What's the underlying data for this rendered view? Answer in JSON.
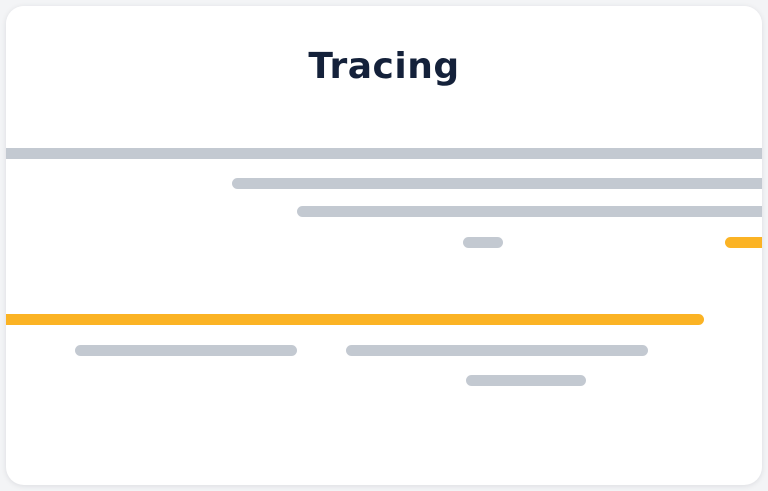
{
  "header": {
    "title": "Tracing"
  },
  "colors": {
    "title": "#14213a",
    "neutral_span": "#c3c9d1",
    "highlight_span": "#fbb324",
    "card_background": "#ffffff"
  },
  "trace": {
    "spans": [
      {
        "id": "span-1",
        "color": "neutral"
      },
      {
        "id": "span-2",
        "color": "neutral"
      },
      {
        "id": "span-3",
        "color": "neutral"
      },
      {
        "id": "span-4",
        "color": "highlight"
      },
      {
        "id": "span-5",
        "color": "highlight"
      },
      {
        "id": "span-6",
        "color": "neutral"
      },
      {
        "id": "span-7",
        "color": "neutral"
      },
      {
        "id": "span-8",
        "color": "neutral"
      }
    ]
  }
}
